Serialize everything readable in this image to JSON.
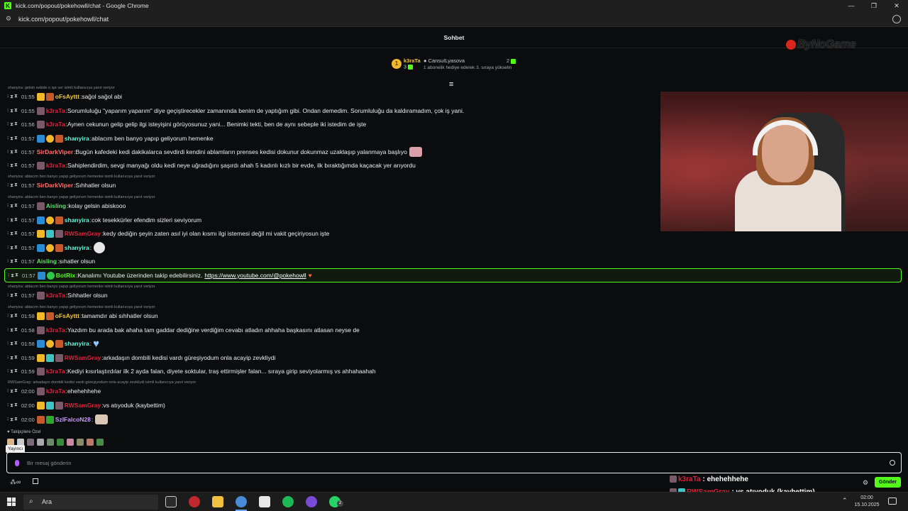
{
  "window": {
    "title": "kick.com/popout/pokehowll/chat - Google Chrome",
    "url": "kick.com/popout/pokehowll/chat"
  },
  "chat_header": {
    "title": "Sohbet"
  },
  "watermark": {
    "text": "ByNoGame"
  },
  "leaderboard": {
    "rank": "1",
    "top_user": "k3raTa",
    "top_count": "3",
    "gift_user": "CansuILyasova",
    "gift_line": "1 abonelik hediye ederek 3. sıraya yükselin",
    "right_count": "2"
  },
  "colors": {
    "kick_green": "#53fc18",
    "k3raTa": "#e0223b",
    "oFsAyttt": "#f0c83a",
    "shanyira": "#6ef0d8",
    "SirDarkViper": "#ff7070",
    "Aisling": "#5fe06a",
    "RWSamGray": "#e0223b",
    "BotRix": "#53fc18",
    "SzlFalcoN28": "#c89aff"
  },
  "messages": [
    {
      "reply": "shanyira: gelsin sekide o işe ver isimli kullanıcıya yanıt veriyor",
      "time": "01:55",
      "badges": [
        "crown",
        "sub"
      ],
      "user": "oFsAyttt",
      "color": "#f0c83a",
      "text": "sağol sağol abi"
    },
    {
      "time": "01:55",
      "badges": [
        "wolf"
      ],
      "user": "k3raTa",
      "color": "#e0223b",
      "text": "Sorumluluğu \"yaparım yaparım\" diye geçiştirecekler zamanında benim de yaptığım gibi. Ondan demedim. Sorumluluğu da kaldıramadım, çok iş yani."
    },
    {
      "time": "01:56",
      "badges": [
        "wolf"
      ],
      "user": "k3raTa",
      "color": "#e0223b",
      "text": "Aynen cekunun gelip gelip ilgi isteyişini görüyosunuz yani... Benimki tekti, ben de aynı sebeple iki istedim de işte"
    },
    {
      "time": "01:57",
      "badges": [
        "verified",
        "gift",
        "sub"
      ],
      "user": "shanyira",
      "color": "#6ef0d8",
      "text": "ablacım ben banyo yapıp geliyorum hemenke"
    },
    {
      "time": "01:57",
      "badges": [],
      "user": "SirDarkViper",
      "color": "#ff7070",
      "text": "Bugün kafedeki kedi dakikalarca sevdirdi kendini ablamların prenses kedisi dokunur dokunmaz uzaklaşıp yalanmaya başlıyo",
      "emote": "pink"
    },
    {
      "time": "01:57",
      "badges": [
        "wolf"
      ],
      "user": "k3raTa",
      "color": "#e0223b",
      "text": "Sahiplendirdim, sevgi manyağı oldu kedi neye uğradığını şaşırdı ahah 5 kadınlı kızlı bir evde, ilk bıraktığımda kaçacak yer arıyordu"
    },
    {
      "reply": "shanyira: ablacım ben banyo yapıp geliyorum hemenke isimli kullanıcıya yanıt veriyor",
      "time": "01:57",
      "badges": [],
      "user": "SirDarkViper",
      "color": "#ff7070",
      "text": "Sıhhatler olsun"
    },
    {
      "reply": "shanyira: ablacım ben banyo yapıp geliyorum hemenke isimli kullanıcıya yanıt veriyor",
      "time": "01:57",
      "badges": [
        "wolf"
      ],
      "user": "Aisling",
      "color": "#5fe06a",
      "text": "kolay gelsin abiskooo"
    },
    {
      "time": "01:57",
      "badges": [
        "verified",
        "gift",
        "sub"
      ],
      "user": "shanyira",
      "color": "#6ef0d8",
      "text": "cok tesekkürler efendim sizleri seviyorum"
    },
    {
      "time": "01:57",
      "badges": [
        "crown",
        "teal",
        "wolf"
      ],
      "user": "RWSamGray",
      "color": "#e0223b",
      "text": "kedy dediğin şeyin zaten asıl iyi olan kısmı ilgi istemesi değil mi vakit geçiriyosun işte"
    },
    {
      "time": "01:57",
      "badges": [
        "verified",
        "gift",
        "sub"
      ],
      "user": "shanyira",
      "color": "#6ef0d8",
      "text": "",
      "emote": "face"
    },
    {
      "time": "01:57",
      "badges": [],
      "user": "Aisling",
      "color": "#5fe06a",
      "text": "sıhatler olsun"
    },
    {
      "time": "01:57",
      "badges": [
        "verified",
        "bot"
      ],
      "user": "BotRix",
      "color": "#53fc18",
      "text": "Kanalımı Youtube üzerinden takip edebilirsiniz.",
      "link": "https://www.youtube.com/@pokehowll",
      "highlight": true
    },
    {
      "reply": "shanyira: ablacım ben banyo yapıp geliyorum hemenke isimli kullanıcıya yanıt veriyor",
      "time": "01:57",
      "badges": [
        "wolf"
      ],
      "user": "k3raTa",
      "color": "#e0223b",
      "text": "Sıhhatler olsun"
    },
    {
      "reply": "shanyira: ablacım ben banyo yapıp geliyorum hemenke isimli kullanıcıya yanıt veriyor",
      "time": "01:58",
      "badges": [
        "crown",
        "sub"
      ],
      "user": "oFsAyttt",
      "color": "#f0c83a",
      "text": "tamamdır abi sıhhatler olsun"
    },
    {
      "time": "01:58",
      "badges": [
        "wolf"
      ],
      "user": "k3raTa",
      "color": "#e0223b",
      "text": "Yazdım bu arada bak ahaha tam gaddar dediğine verdiğim cevabı atladın ahhaha başkasını atlasan neyse de"
    },
    {
      "time": "01:58",
      "badges": [
        "verified",
        "gift",
        "sub"
      ],
      "user": "shanyira",
      "color": "#6ef0d8",
      "text": "",
      "emote": "heart"
    },
    {
      "time": "01:59",
      "badges": [
        "crown",
        "teal",
        "wolf"
      ],
      "user": "RWSamGray",
      "color": "#e0223b",
      "text": "arkadaşın dombili kedisi vardı güreşiyodum onla acayip zevkliydi"
    },
    {
      "time": "01:59",
      "badges": [
        "wolf"
      ],
      "user": "k3raTa",
      "color": "#e0223b",
      "text": "Kediyi kısırlaştırdılar ilk 2 ayda falan, diyete soktular, traş ettirmişler falan... sıraya girip seviyolarmış vs ahhahaahah"
    },
    {
      "reply": "RWSamGray: arkadaşın dombili kedisi vardı güreşiyodum onla acayip zevkliydi isimli kullanıcıya yanıt veriyor",
      "time": "02:00",
      "badges": [
        "wolf"
      ],
      "user": "k3raTa",
      "color": "#e0223b",
      "text": "ehehehhehe"
    },
    {
      "time": "02:00",
      "badges": [
        "crown",
        "teal",
        "wolf"
      ],
      "user": "RWSamGray",
      "color": "#e0223b",
      "text": "vs atıyoduk (kaybettim)"
    },
    {
      "time": "02:00",
      "badges": [
        "sub",
        "vip"
      ],
      "user": "SzlFalcoN28",
      "color": "#c89aff",
      "text": "",
      "emote": "cat"
    }
  ],
  "followers": {
    "label": "Takipçilere Özel"
  },
  "tooltip": {
    "text": "Yayıncı"
  },
  "input": {
    "placeholder": "Bir mesaj gönderin"
  },
  "toolbar": {
    "send_label": "Gönder"
  },
  "overlay": [
    {
      "user": "k3raTa",
      "color": "#e0223b",
      "text": ": ehehehhehe"
    },
    {
      "user": "RWSamGray",
      "color": "#e0223b",
      "text": ": vs atıyoduk (kaybettim)"
    },
    {
      "user": "SzlFalcoN28",
      "color": "#c89aff",
      "text": ":"
    }
  ],
  "taskbar": {
    "search": "Ara",
    "time": "02:00",
    "date": "15.10.2025",
    "whatsapp_badge": "2"
  }
}
